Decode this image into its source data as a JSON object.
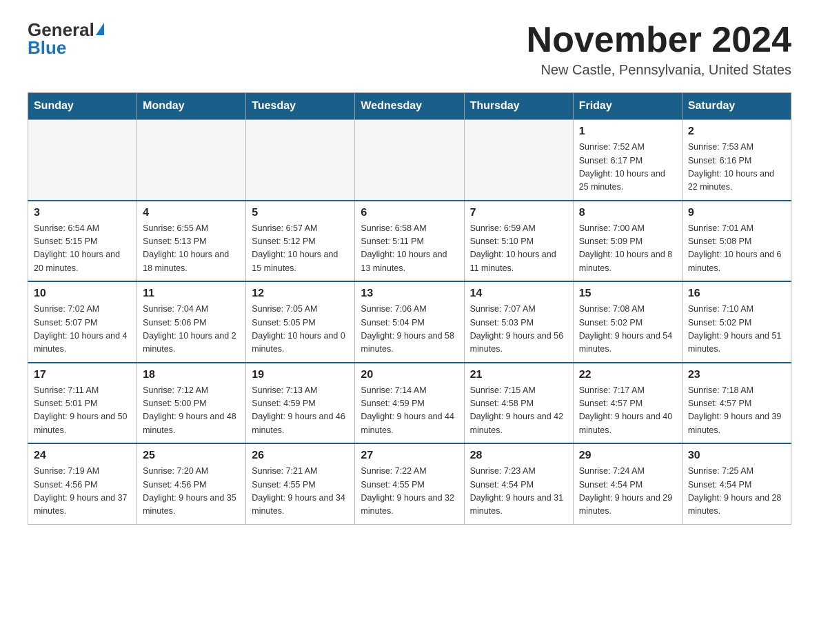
{
  "header": {
    "logo_general": "General",
    "logo_blue": "Blue",
    "month_title": "November 2024",
    "location": "New Castle, Pennsylvania, United States"
  },
  "days_of_week": [
    "Sunday",
    "Monday",
    "Tuesday",
    "Wednesday",
    "Thursday",
    "Friday",
    "Saturday"
  ],
  "weeks": [
    [
      {
        "day": "",
        "sunrise": "",
        "sunset": "",
        "daylight": "",
        "empty": true
      },
      {
        "day": "",
        "sunrise": "",
        "sunset": "",
        "daylight": "",
        "empty": true
      },
      {
        "day": "",
        "sunrise": "",
        "sunset": "",
        "daylight": "",
        "empty": true
      },
      {
        "day": "",
        "sunrise": "",
        "sunset": "",
        "daylight": "",
        "empty": true
      },
      {
        "day": "",
        "sunrise": "",
        "sunset": "",
        "daylight": "",
        "empty": true
      },
      {
        "day": "1",
        "sunrise": "Sunrise: 7:52 AM",
        "sunset": "Sunset: 6:17 PM",
        "daylight": "Daylight: 10 hours and 25 minutes.",
        "empty": false
      },
      {
        "day": "2",
        "sunrise": "Sunrise: 7:53 AM",
        "sunset": "Sunset: 6:16 PM",
        "daylight": "Daylight: 10 hours and 22 minutes.",
        "empty": false
      }
    ],
    [
      {
        "day": "3",
        "sunrise": "Sunrise: 6:54 AM",
        "sunset": "Sunset: 5:15 PM",
        "daylight": "Daylight: 10 hours and 20 minutes.",
        "empty": false
      },
      {
        "day": "4",
        "sunrise": "Sunrise: 6:55 AM",
        "sunset": "Sunset: 5:13 PM",
        "daylight": "Daylight: 10 hours and 18 minutes.",
        "empty": false
      },
      {
        "day": "5",
        "sunrise": "Sunrise: 6:57 AM",
        "sunset": "Sunset: 5:12 PM",
        "daylight": "Daylight: 10 hours and 15 minutes.",
        "empty": false
      },
      {
        "day": "6",
        "sunrise": "Sunrise: 6:58 AM",
        "sunset": "Sunset: 5:11 PM",
        "daylight": "Daylight: 10 hours and 13 minutes.",
        "empty": false
      },
      {
        "day": "7",
        "sunrise": "Sunrise: 6:59 AM",
        "sunset": "Sunset: 5:10 PM",
        "daylight": "Daylight: 10 hours and 11 minutes.",
        "empty": false
      },
      {
        "day": "8",
        "sunrise": "Sunrise: 7:00 AM",
        "sunset": "Sunset: 5:09 PM",
        "daylight": "Daylight: 10 hours and 8 minutes.",
        "empty": false
      },
      {
        "day": "9",
        "sunrise": "Sunrise: 7:01 AM",
        "sunset": "Sunset: 5:08 PM",
        "daylight": "Daylight: 10 hours and 6 minutes.",
        "empty": false
      }
    ],
    [
      {
        "day": "10",
        "sunrise": "Sunrise: 7:02 AM",
        "sunset": "Sunset: 5:07 PM",
        "daylight": "Daylight: 10 hours and 4 minutes.",
        "empty": false
      },
      {
        "day": "11",
        "sunrise": "Sunrise: 7:04 AM",
        "sunset": "Sunset: 5:06 PM",
        "daylight": "Daylight: 10 hours and 2 minutes.",
        "empty": false
      },
      {
        "day": "12",
        "sunrise": "Sunrise: 7:05 AM",
        "sunset": "Sunset: 5:05 PM",
        "daylight": "Daylight: 10 hours and 0 minutes.",
        "empty": false
      },
      {
        "day": "13",
        "sunrise": "Sunrise: 7:06 AM",
        "sunset": "Sunset: 5:04 PM",
        "daylight": "Daylight: 9 hours and 58 minutes.",
        "empty": false
      },
      {
        "day": "14",
        "sunrise": "Sunrise: 7:07 AM",
        "sunset": "Sunset: 5:03 PM",
        "daylight": "Daylight: 9 hours and 56 minutes.",
        "empty": false
      },
      {
        "day": "15",
        "sunrise": "Sunrise: 7:08 AM",
        "sunset": "Sunset: 5:02 PM",
        "daylight": "Daylight: 9 hours and 54 minutes.",
        "empty": false
      },
      {
        "day": "16",
        "sunrise": "Sunrise: 7:10 AM",
        "sunset": "Sunset: 5:02 PM",
        "daylight": "Daylight: 9 hours and 51 minutes.",
        "empty": false
      }
    ],
    [
      {
        "day": "17",
        "sunrise": "Sunrise: 7:11 AM",
        "sunset": "Sunset: 5:01 PM",
        "daylight": "Daylight: 9 hours and 50 minutes.",
        "empty": false
      },
      {
        "day": "18",
        "sunrise": "Sunrise: 7:12 AM",
        "sunset": "Sunset: 5:00 PM",
        "daylight": "Daylight: 9 hours and 48 minutes.",
        "empty": false
      },
      {
        "day": "19",
        "sunrise": "Sunrise: 7:13 AM",
        "sunset": "Sunset: 4:59 PM",
        "daylight": "Daylight: 9 hours and 46 minutes.",
        "empty": false
      },
      {
        "day": "20",
        "sunrise": "Sunrise: 7:14 AM",
        "sunset": "Sunset: 4:59 PM",
        "daylight": "Daylight: 9 hours and 44 minutes.",
        "empty": false
      },
      {
        "day": "21",
        "sunrise": "Sunrise: 7:15 AM",
        "sunset": "Sunset: 4:58 PM",
        "daylight": "Daylight: 9 hours and 42 minutes.",
        "empty": false
      },
      {
        "day": "22",
        "sunrise": "Sunrise: 7:17 AM",
        "sunset": "Sunset: 4:57 PM",
        "daylight": "Daylight: 9 hours and 40 minutes.",
        "empty": false
      },
      {
        "day": "23",
        "sunrise": "Sunrise: 7:18 AM",
        "sunset": "Sunset: 4:57 PM",
        "daylight": "Daylight: 9 hours and 39 minutes.",
        "empty": false
      }
    ],
    [
      {
        "day": "24",
        "sunrise": "Sunrise: 7:19 AM",
        "sunset": "Sunset: 4:56 PM",
        "daylight": "Daylight: 9 hours and 37 minutes.",
        "empty": false
      },
      {
        "day": "25",
        "sunrise": "Sunrise: 7:20 AM",
        "sunset": "Sunset: 4:56 PM",
        "daylight": "Daylight: 9 hours and 35 minutes.",
        "empty": false
      },
      {
        "day": "26",
        "sunrise": "Sunrise: 7:21 AM",
        "sunset": "Sunset: 4:55 PM",
        "daylight": "Daylight: 9 hours and 34 minutes.",
        "empty": false
      },
      {
        "day": "27",
        "sunrise": "Sunrise: 7:22 AM",
        "sunset": "Sunset: 4:55 PM",
        "daylight": "Daylight: 9 hours and 32 minutes.",
        "empty": false
      },
      {
        "day": "28",
        "sunrise": "Sunrise: 7:23 AM",
        "sunset": "Sunset: 4:54 PM",
        "daylight": "Daylight: 9 hours and 31 minutes.",
        "empty": false
      },
      {
        "day": "29",
        "sunrise": "Sunrise: 7:24 AM",
        "sunset": "Sunset: 4:54 PM",
        "daylight": "Daylight: 9 hours and 29 minutes.",
        "empty": false
      },
      {
        "day": "30",
        "sunrise": "Sunrise: 7:25 AM",
        "sunset": "Sunset: 4:54 PM",
        "daylight": "Daylight: 9 hours and 28 minutes.",
        "empty": false
      }
    ]
  ]
}
